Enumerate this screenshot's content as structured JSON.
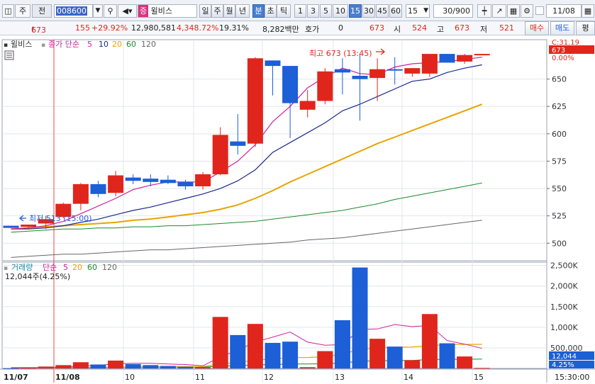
{
  "toolbar": {
    "type_label": "주",
    "prev_label": "전",
    "code": "008600",
    "mode_badge": "증",
    "stock_name": "윌비스",
    "periods": [
      "일",
      "주",
      "월",
      "년",
      "분",
      "초",
      "틱"
    ],
    "active_period": "분",
    "intervals": [
      "1",
      "3",
      "5",
      "10",
      "15",
      "30",
      "45",
      "60"
    ],
    "active_interval": "15",
    "interval_select": "15",
    "count_value": "30",
    "count_total": "/900",
    "date_value": "11/08"
  },
  "quote": {
    "price": "673",
    "change": "155",
    "change_pct": "+29.92%",
    "volume": "12,980,581",
    "volume_ratio": "4,348.72%",
    "turnover": "19.31%",
    "amount": "8,282백만",
    "hoga_label": "호가",
    "hoga_value": "0",
    "hoga_price": "673",
    "open_label": "시",
    "open_value": "524",
    "high_label": "고",
    "high_value": "673",
    "low_label": "저",
    "low_value": "521",
    "buy_label": "매수",
    "sell_label": "매도",
    "eval_label": "평"
  },
  "price_legend": {
    "stock": "윌비스",
    "ma_prefix": "종가 단순",
    "periods": [
      "5",
      "10",
      "20",
      "60",
      "120"
    ]
  },
  "volume_legend": {
    "label": "거래량",
    "ma_prefix": "단순",
    "periods": [
      "5",
      "20",
      "60",
      "120"
    ],
    "current": "12,044주(4.25%)"
  },
  "annotations": {
    "high": "최고 673 (13:45)",
    "low": "최저 513 (15:00)",
    "top_right": "C:31.19"
  },
  "price_tag": "673",
  "price_pct": "0.00%",
  "volume_tag": "12,044",
  "volume_pct_tag": "4.25%",
  "time_axis": [
    "11/07",
    "11/08",
    "10",
    "11",
    "12",
    "13",
    "14",
    "15"
  ],
  "time_right": "15:30:00",
  "price_ticks": [
    "650",
    "625",
    "600",
    "575",
    "550",
    "525",
    "500"
  ],
  "volume_ticks": [
    "2,500K",
    "2,000K",
    "1,500K",
    "1,000K",
    "500,000"
  ],
  "colors": {
    "up": "#e0261c",
    "down": "#1c5fd6",
    "ma5": "#d0209a",
    "ma10": "#1a2a8a",
    "ma20": "#e8a400",
    "ma60": "#1a8a2a",
    "ma120": "#666666"
  },
  "chart_data": {
    "type": "candlestick",
    "price_candles": [
      {
        "o": 516,
        "h": 516,
        "l": 514,
        "c": 514
      },
      {
        "o": 515,
        "h": 517,
        "l": 513,
        "c": 517
      },
      {
        "o": 518,
        "h": 525,
        "l": 513,
        "c": 522
      },
      {
        "o": 524,
        "h": 537,
        "l": 523,
        "c": 536
      },
      {
        "o": 536,
        "h": 555,
        "l": 530,
        "c": 554
      },
      {
        "o": 554,
        "h": 557,
        "l": 542,
        "c": 545
      },
      {
        "o": 546,
        "h": 566,
        "l": 543,
        "c": 562
      },
      {
        "o": 560,
        "h": 563,
        "l": 554,
        "c": 557
      },
      {
        "o": 559,
        "h": 563,
        "l": 552,
        "c": 556
      },
      {
        "o": 558,
        "h": 562,
        "l": 554,
        "c": 555
      },
      {
        "o": 556,
        "h": 558,
        "l": 549,
        "c": 552
      },
      {
        "o": 552,
        "h": 565,
        "l": 549,
        "c": 563
      },
      {
        "o": 563,
        "h": 606,
        "l": 562,
        "c": 599
      },
      {
        "o": 593,
        "h": 618,
        "l": 581,
        "c": 589
      },
      {
        "o": 591,
        "h": 670,
        "l": 588,
        "c": 669
      },
      {
        "o": 667,
        "h": 667,
        "l": 635,
        "c": 662
      },
      {
        "o": 662,
        "h": 660,
        "l": 596,
        "c": 628
      },
      {
        "o": 622,
        "h": 640,
        "l": 615,
        "c": 630
      },
      {
        "o": 630,
        "h": 660,
        "l": 627,
        "c": 657
      },
      {
        "o": 659,
        "h": 669,
        "l": 636,
        "c": 656
      },
      {
        "o": 653,
        "h": 673,
        "l": 612,
        "c": 650
      },
      {
        "o": 651,
        "h": 669,
        "l": 630,
        "c": 659
      },
      {
        "o": 659,
        "h": 670,
        "l": 645,
        "c": 658
      },
      {
        "o": 655,
        "h": 658,
        "l": 652,
        "c": 660
      },
      {
        "o": 655,
        "h": 673,
        "l": 652,
        "c": 673
      },
      {
        "o": 673,
        "h": 673,
        "l": 665,
        "c": 665
      },
      {
        "o": 666,
        "h": 673,
        "l": 664,
        "c": 672
      },
      {
        "o": 673,
        "h": 673,
        "l": 673,
        "c": 673
      }
    ],
    "ma5": [
      513,
      514,
      516,
      520,
      527,
      534,
      541,
      549,
      553,
      556,
      556,
      556,
      565,
      575,
      590,
      611,
      625,
      642,
      652,
      660,
      655,
      654,
      661,
      664,
      665,
      666,
      668,
      670
    ],
    "ma10": [
      513,
      513,
      514,
      516,
      519,
      522,
      526,
      530,
      533,
      537,
      541,
      545,
      550,
      557,
      567,
      583,
      592,
      601,
      610,
      621,
      627,
      634,
      641,
      648,
      650,
      656,
      660,
      663
    ],
    "ma20": [
      513,
      514,
      515,
      516,
      517,
      518,
      519,
      521,
      522,
      524,
      526,
      528,
      531,
      535,
      541,
      548,
      556,
      563,
      570,
      577,
      584,
      591,
      597,
      603,
      609,
      615,
      621,
      627
    ],
    "ma60": [
      510,
      511,
      512,
      513,
      513,
      514,
      514,
      515,
      515,
      516,
      516,
      517,
      518,
      519,
      520,
      522,
      524,
      526,
      528,
      530,
      533,
      536,
      540,
      543,
      546,
      549,
      552,
      555
    ],
    "ma120": [
      487,
      488,
      489,
      490,
      490,
      491,
      492,
      493,
      494,
      494,
      495,
      496,
      497,
      498,
      499,
      500,
      501,
      503,
      504,
      505,
      507,
      509,
      511,
      513,
      515,
      517,
      519,
      521
    ],
    "volume": [
      5,
      12,
      45,
      80,
      150,
      95,
      190,
      105,
      80,
      60,
      40,
      30,
      1250,
      810,
      1080,
      620,
      650,
      30,
      420,
      1170,
      2450,
      720,
      530,
      200,
      1320,
      610,
      290,
      12
    ],
    "volume_ma5": [
      5,
      8,
      20,
      35,
      58,
      76,
      112,
      124,
      124,
      106,
      95,
      63,
      280,
      442,
      642,
      758,
      882,
      638,
      562,
      578,
      944,
      958,
      1064,
      1014,
      1044,
      676,
      590,
      487
    ],
    "volume_ma20": [
      10,
      11,
      13,
      15,
      19,
      22,
      30,
      35,
      39,
      42,
      44,
      45,
      108,
      148,
      202,
      230,
      264,
      265,
      286,
      344,
      466,
      495,
      514,
      519,
      552,
      576,
      583,
      584
    ],
    "volume_ma60": [
      20,
      20,
      21,
      22,
      24,
      25,
      27,
      29,
      30,
      31,
      32,
      33,
      53,
      67,
      85,
      95,
      106,
      107,
      114,
      133,
      173,
      184,
      192,
      195,
      216,
      222,
      224,
      225
    ],
    "price_ylim": [
      484,
      686
    ],
    "volume_ylim": [
      0,
      2580
    ]
  }
}
